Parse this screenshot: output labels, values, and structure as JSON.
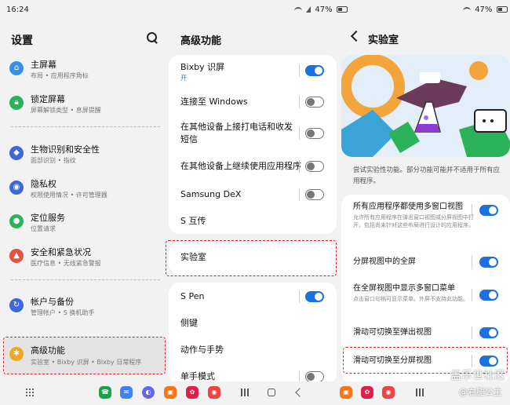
{
  "status": {
    "time": "16:24",
    "battery_left": "47%",
    "battery_right": "47%"
  },
  "settings": {
    "title": "设置",
    "items": [
      {
        "title": "主屏幕",
        "sub": "布局 • 应用程序角标",
        "icon": "home-icon",
        "color": "#3a8ee6"
      },
      {
        "title": "锁定屏幕",
        "sub": "屏幕解锁类型 • 息屏提醒",
        "icon": "lock-icon",
        "color": "#2bb35a"
      },
      {
        "title": "生物识别和安全性",
        "sub": "面部识别 • 指纹",
        "icon": "shield-icon",
        "color": "#3d68d8"
      },
      {
        "title": "隐私权",
        "sub": "权限使用情况 • 许可管理器",
        "icon": "privacy-icon",
        "color": "#3d68d8"
      },
      {
        "title": "定位服务",
        "sub": "位置请求",
        "icon": "location-icon",
        "color": "#2bb35a"
      },
      {
        "title": "安全和紧急状况",
        "sub": "医疗信息 • 无线紧急警报",
        "icon": "emergency-icon",
        "color": "#e2543e"
      },
      {
        "title": "帐户与备份",
        "sub": "管理帐户 • S 换机助手",
        "icon": "sync-icon",
        "color": "#3d68d8"
      },
      {
        "title": "高级功能",
        "sub": "实验室 • Bixby 识屏 • Bixby 日常程序",
        "icon": "gear-plus-icon",
        "color": "#f0a623"
      }
    ]
  },
  "advanced": {
    "title": "高级功能",
    "group1": [
      {
        "label": "Bixby 识屏",
        "sub": "开",
        "toggle": "on"
      },
      {
        "label": "连接至 Windows",
        "toggle": "off"
      },
      {
        "label": "在其他设备上接打电话和收发短信",
        "toggle": "off"
      },
      {
        "label": "在其他设备上继续使用应用程序",
        "toggle": "off"
      },
      {
        "label": "Samsung DeX",
        "toggle": "off"
      },
      {
        "label": "S 互传"
      }
    ],
    "lab_label": "实验室",
    "group2": [
      {
        "label": "S Pen",
        "toggle": "on"
      },
      {
        "label": "侧键"
      },
      {
        "label": "动作与手势"
      },
      {
        "label": "单手模式",
        "toggle": "off"
      }
    ]
  },
  "labs": {
    "title": "实验室",
    "description": "尝试实验性功能。部分功能可能并不适用于所有应用程序。",
    "rows": [
      {
        "label": "所有应用程序都使用多窗口视图",
        "note": "允许所有应用程序在弹出窗口视图或分屏视图中打开，包括尚未针对这些布局进行设计的应用程序。",
        "toggle": "on"
      },
      {
        "label": "分屏视图中的全屏",
        "toggle": "on"
      },
      {
        "label": "在全屏视图中显示多窗口菜单",
        "note": "点击窗口句柄可显示菜单。外屏不支持此功能。",
        "toggle": "on"
      },
      {
        "label": "滑动可切换至弹出视图",
        "toggle": "on"
      },
      {
        "label": "滑动可切换至分屏视图",
        "toggle": "on"
      }
    ]
  },
  "watermark": {
    "line1": "盖乐世社区",
    "line2": "@右腿公主"
  }
}
